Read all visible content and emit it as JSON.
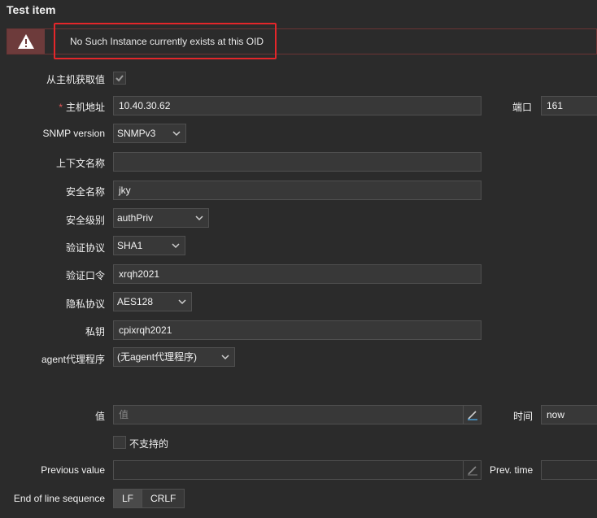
{
  "dialog": {
    "title": "Test item"
  },
  "alert": {
    "message": "No Such Instance currently exists at this OID",
    "icon": "warning-icon"
  },
  "form": {
    "get_from_host": {
      "label": "从主机获取值",
      "checked": true
    },
    "host_address": {
      "label": "主机地址",
      "required_mark": "*",
      "value": "10.40.30.62"
    },
    "port": {
      "label": "端口",
      "value": "161"
    },
    "snmp_version": {
      "label": "SNMP version",
      "value": "SNMPv3"
    },
    "context_name": {
      "label": "上下文名称",
      "value": ""
    },
    "security_name": {
      "label": "安全名称",
      "value": "jky"
    },
    "security_level": {
      "label": "安全级别",
      "value": "authPriv"
    },
    "auth_protocol": {
      "label": "验证协议",
      "value": "SHA1"
    },
    "auth_passphrase": {
      "label": "验证口令",
      "value": "xrqh2021"
    },
    "priv_protocol": {
      "label": "隐私协议",
      "value": "AES128"
    },
    "priv_key": {
      "label": "私钥",
      "value": "cpixrqh2021"
    },
    "agent": {
      "label": "agent代理程序",
      "value": "(无agent代理程序)"
    },
    "value": {
      "label": "值",
      "placeholder": "值"
    },
    "time": {
      "label": "时间",
      "value": "now"
    },
    "not_supported": {
      "label": "不支持的",
      "checked": false
    },
    "previous_value": {
      "label": "Previous value",
      "value": ""
    },
    "prev_time": {
      "label": "Prev. time",
      "value": ""
    },
    "eol": {
      "label": "End of line sequence",
      "options": [
        "LF",
        "CRLF"
      ],
      "selected": "LF"
    }
  },
  "colors": {
    "background": "#2b2b2b",
    "input_bg": "#383838",
    "alert_bg": "#6d3b3b",
    "highlight": "#e5262a"
  }
}
